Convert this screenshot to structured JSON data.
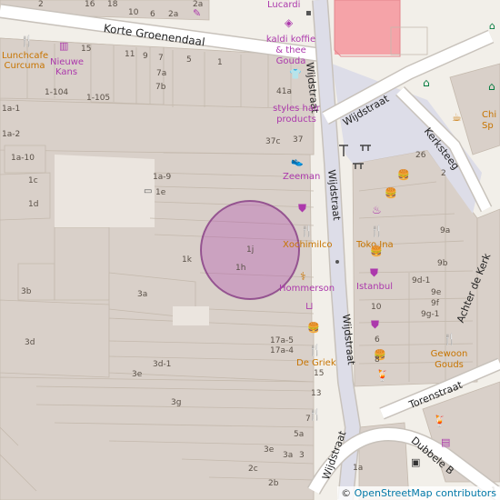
{
  "map": {
    "streets": {
      "korte_groenendaal": "Korte Groenendaal",
      "wijdstraat_upper_right": "Wijdstraat",
      "wijdstraat_main": "Wijdstraat",
      "wijdstraat_lower": "Wijdstraat",
      "wijdstraat_bottom": "Wijdstraat",
      "kerksteeg": "Kerksteeg",
      "achter_de_kerk": "Achter de Kerk",
      "torenstraat": "Torenstraat",
      "dubbele_b": "Dubbele B"
    },
    "pois": {
      "lucardi": "Lucardi",
      "kaldi": "kaldi koffie\n& thee\nGouda",
      "lunchcafe": "Lunchcafe\nCurcuma",
      "nieuwe_kans": "Nieuwe\nKans",
      "styles": "styles hair\nproducts",
      "zeeman": "Zeeman",
      "xochimilco": "Xochimilco",
      "hommerson": "Hommerson",
      "de_griek": "De Griek",
      "toko_ina": "Toko Ina",
      "istanbul": "Istanbul",
      "gewoon_goude": "Gewoon\nGouds",
      "chi": "Chi\nSp"
    },
    "house_numbers": [
      "2",
      "16",
      "10",
      "6",
      "2a",
      "18",
      "15",
      "11",
      "9",
      "7",
      "5",
      "1",
      "7a",
      "7b",
      "1-104",
      "1-105",
      "41a",
      "1a-1",
      "37c",
      "37",
      "1a-2",
      "1a-10",
      "1a-9",
      "1c",
      "1e",
      "1d",
      "1k",
      "1j",
      "1h",
      "3b",
      "3a",
      "3d",
      "17a-5",
      "17a-4",
      "3d-1",
      "3e",
      "15",
      "13",
      "3g",
      "7",
      "5a",
      "3e",
      "3a",
      "3",
      "2c",
      "2b",
      "1a",
      "26",
      "2",
      "9a",
      "9b",
      "9d-1",
      "9e",
      "9f",
      "9g-1",
      "10",
      "6",
      "8",
      "1"
    ],
    "attribution": {
      "symbol": "©",
      "link": "OpenStreetMap contributors"
    },
    "colors": {
      "background": "#f2efe9",
      "building": "#d9d0c9",
      "road": "#ffffff",
      "road_casing": "#c8c2bb",
      "pedestrian": "#dddde8",
      "circle_fill": "#ac39ac",
      "circle_stroke": "#7a2a7a",
      "pink_area": "#f5a3a8",
      "poi_purple": "#ac39ac",
      "poi_orange": "#c77400"
    },
    "circle": {
      "center_label": "1j"
    }
  }
}
